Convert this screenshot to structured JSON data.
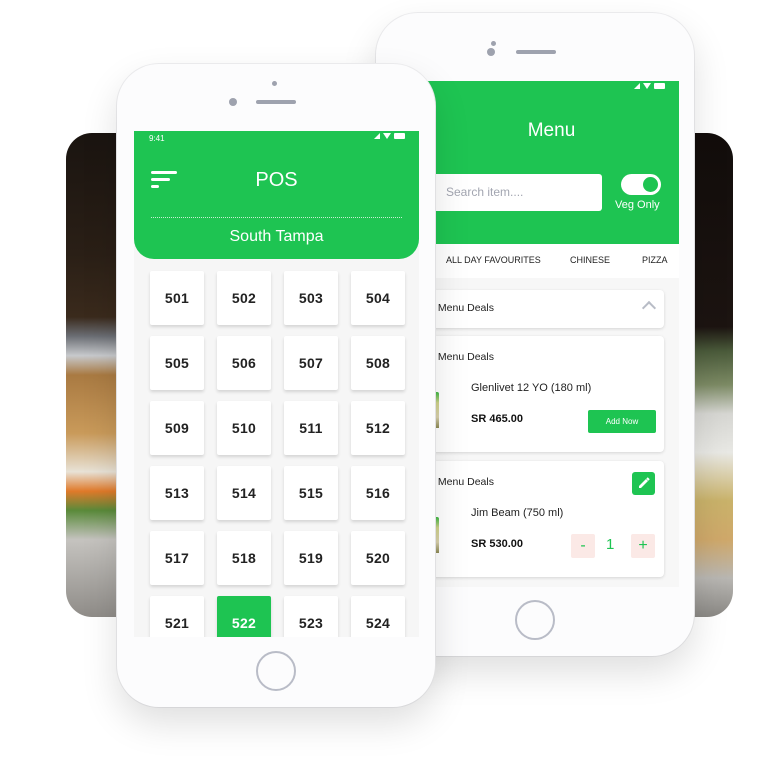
{
  "pos_app": {
    "status_time": "9:41",
    "title": "POS",
    "location": "South Tampa",
    "selected_table": "522",
    "tables": [
      "501",
      "502",
      "503",
      "504",
      "505",
      "506",
      "507",
      "508",
      "509",
      "510",
      "511",
      "512",
      "513",
      "514",
      "515",
      "516",
      "517",
      "518",
      "519",
      "520",
      "521",
      "522",
      "523",
      "524"
    ]
  },
  "menu_app": {
    "title": "Menu",
    "search": {
      "placeholder": "Search item...."
    },
    "veg_toggle": {
      "label": "Veg Only",
      "on": true
    },
    "tabs": [
      "ALL DAY FAVOURITES",
      "CHINESE",
      "PIZZA"
    ],
    "section": {
      "title": "ttle Menu Deals",
      "expanded": true
    },
    "items": [
      {
        "category": "ttle Menu Deals",
        "name": "Glenlivet 12 YO (180 ml)",
        "price": "SR 465.00",
        "action_label": "Add Now"
      },
      {
        "category": "ttle Menu Deals",
        "name": "Jim Beam (750 ml)",
        "price": "SR 530.00",
        "quantity": "1",
        "minus_label": "-",
        "plus_label": "+"
      }
    ]
  },
  "colors": {
    "brand_green": "#1ec452",
    "tab_indicator": "#e56a2c",
    "qty_bg": "#fbe9e6"
  }
}
